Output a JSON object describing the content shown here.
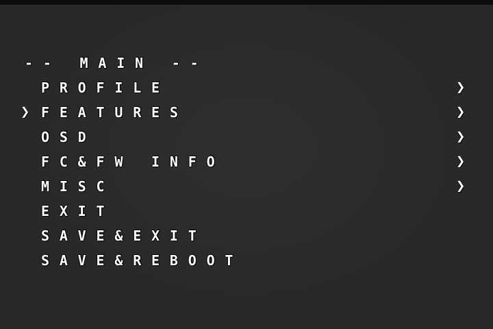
{
  "menu": {
    "title": "-- MAIN --",
    "cursor_glyph": "❯",
    "submenu_glyph": "❯",
    "selected_index": 1,
    "items": [
      {
        "label": "PROFILE",
        "has_submenu": true
      },
      {
        "label": "FEATURES",
        "has_submenu": true
      },
      {
        "label": "OSD",
        "has_submenu": true
      },
      {
        "label": "FC&FW INFO",
        "has_submenu": true
      },
      {
        "label": "MISC",
        "has_submenu": true
      },
      {
        "label": "EXIT",
        "has_submenu": false
      },
      {
        "label": "SAVE&EXIT",
        "has_submenu": false
      },
      {
        "label": "SAVE&REBOOT",
        "has_submenu": false
      }
    ]
  },
  "colors": {
    "text": "#ffffff",
    "background": "#262626"
  }
}
